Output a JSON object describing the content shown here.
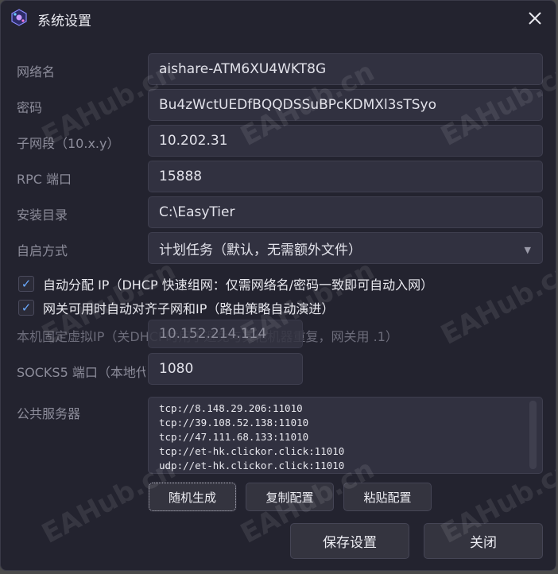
{
  "window": {
    "title": "系统设置",
    "close_icon": "close-icon"
  },
  "form": {
    "network_name": {
      "label": "网络名",
      "value": "aishare-ATM6XU4WKT8G"
    },
    "password": {
      "label": "密码",
      "value": "Bu4zWctUEDfBQQDSSuBPcKDMXl3sTSyo"
    },
    "subnet": {
      "label": "子网段（10.x.y）",
      "value": "10.202.31"
    },
    "rpc_port": {
      "label": "RPC 端口",
      "value": "15888"
    },
    "install_dir": {
      "label": "安装目录",
      "value": "C:\\EasyTier"
    },
    "autostart": {
      "label": "自启方式",
      "value": "计划任务（默认，无需额外文件）"
    },
    "auto_ip": {
      "checked": true,
      "label": "自动分配 IP（DHCP 快速组网：仅需网络名/密码一致即可自动入网）"
    },
    "gateway_align": {
      "checked": true,
      "label": "网关可用时自动对齐子网和IP（路由策略自动演进）"
    },
    "fixed_ip": {
      "label": "本机固定虚拟IP（关DHCP时用于避免与其他机器重复，网关用 .1）",
      "value": "10.152.214.114"
    },
    "socks5_port": {
      "label": "SOCKS5 端口（本地代理）",
      "value": "1080"
    },
    "public_servers": {
      "label": "公共服务器",
      "lines": [
        "tcp://8.148.29.206:11010",
        "tcp://39.108.52.138:11010",
        "tcp://47.111.68.133:11010",
        "tcp://et-hk.clickor.click:11010",
        "udp://et-hk.clickor.click:11010"
      ]
    }
  },
  "buttons": {
    "random": "随机生成",
    "copy": "复制配置",
    "paste": "粘贴配置",
    "save": "保存设置",
    "close": "关闭"
  },
  "watermark": "EAHub.cn",
  "colors": {
    "background": "#23232f",
    "field": "#313140",
    "accent": "#6aa9ff"
  }
}
